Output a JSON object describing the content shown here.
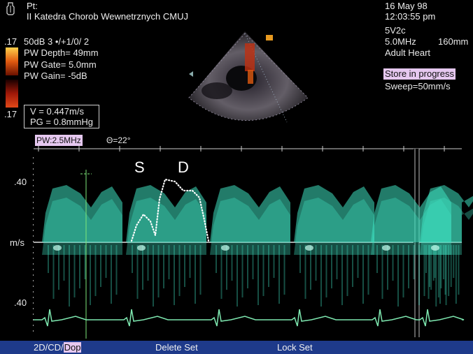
{
  "header": {
    "patient_label": "Pt:",
    "institution": "II Katedra Chorob Wewnetrznych CMUJ",
    "date": "16 May 98",
    "time": "12:03:55 pm"
  },
  "settings_left": {
    "scale_value": ".17",
    "line1": "50dB  3 •/+1/0/ 2",
    "pw_depth": "PW Depth=  49mm",
    "pw_gate": "PW Gate=  5.0mm",
    "pw_gain": "PW Gain=  -5dB",
    "scale_bottom": ".17"
  },
  "measurements": {
    "velocity": "V = 0.447m/s",
    "pressure_gradient": "PG = 0.8mmHg"
  },
  "settings_right": {
    "probe": "5V2c",
    "frequency": "5.0MHz",
    "depth": "160mm",
    "preset": "Adult Heart",
    "store_status": "Store in progress",
    "sweep": "Sweep=50mm/s"
  },
  "doppler_bar": {
    "pw_freq": "PW:2.5MHz",
    "angle": "Θ=22°"
  },
  "spectral": {
    "label_s": "S",
    "label_d": "D",
    "axis_top": ".40",
    "axis_unit": "m/s",
    "axis_bottom": ".40"
  },
  "bottom_menu": {
    "mode_prefix": "2D/CD/",
    "mode_active": "Dop",
    "delete_set": "Delete Set",
    "lock_set": "Lock Set"
  },
  "colors": {
    "doppler_cyan": "#3ee0c0",
    "ecg_green": "#7ee8b0",
    "highlight": "#e6c8f0",
    "menu_bar": "#1e3a8a"
  }
}
